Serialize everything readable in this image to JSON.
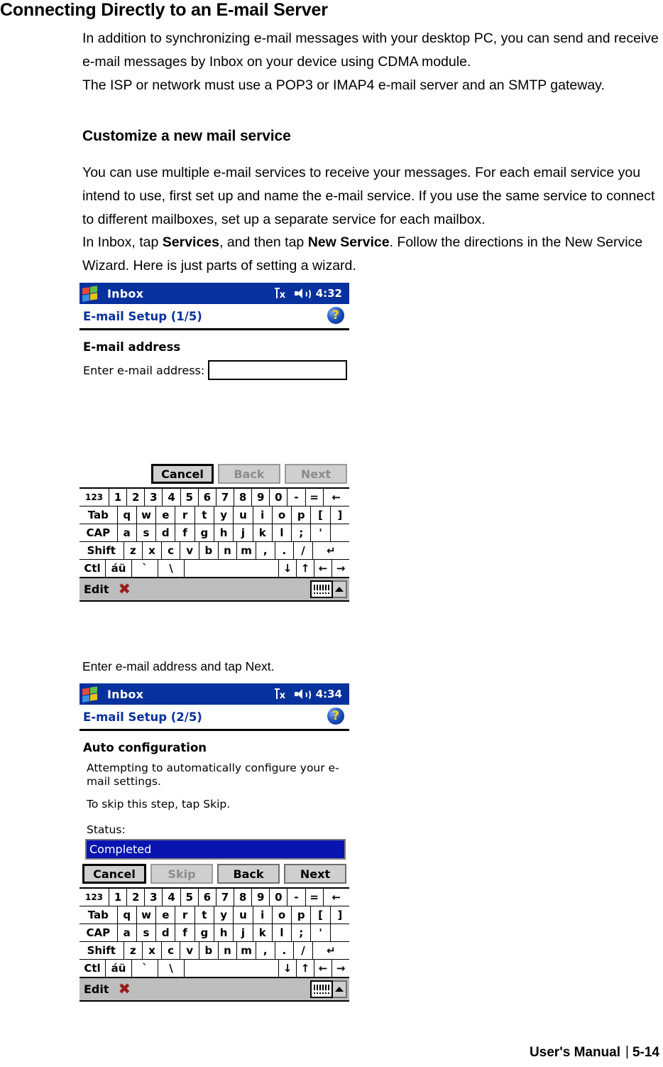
{
  "document": {
    "heading": "Connecting Directly to an E-mail Server",
    "intro_paragraph_1": "In addition to synchronizing e-mail messages with your desktop PC, you can send and receive e-mail messages by Inbox on your device using CDMA module.",
    "intro_paragraph_2": "The ISP or network must use a POP3 or IMAP4 e-mail server and an SMTP gateway.",
    "subheading": "Customize a new mail service",
    "body_paragraph_1": "You can use multiple e-mail services to receive your messages. For each email service you intend to use, first set up and name the e-mail service. If you use the same service to connect to different mailboxes, set up a separate service for each mailbox.",
    "body_paragraph_2_a": "In Inbox, tap ",
    "body_paragraph_2_b": "Services",
    "body_paragraph_2_c": ", and then tap ",
    "body_paragraph_2_d": "New Service",
    "body_paragraph_2_e": ". Follow the directions in the New Service Wizard. Here is just parts of setting a wizard.",
    "caption_1": "Enter e-mail address and tap Next.",
    "footer_label": "User's Manual",
    "footer_separator": "|",
    "footer_page": "5-14"
  },
  "colors": {
    "titlebar_blue": "#07319c",
    "link_blue": "#07319c",
    "status_highlight": "#0a14b0",
    "keyboard_gray": "#bdbdbd",
    "button_face": "#cfcfcf"
  },
  "screenshot1": {
    "app_title": "Inbox",
    "clock": "4:32",
    "signal_icon": "signal-no-service-icon",
    "volume_icon": "speaker-icon",
    "wizard_title": "E-mail Setup (1/5)",
    "help_icon": "help-question-icon",
    "section_heading": "E-mail address",
    "field_label": "Enter e-mail address:",
    "field_value": "",
    "buttons": [
      {
        "label": "Cancel",
        "state": "default"
      },
      {
        "label": "Back",
        "state": "disabled"
      },
      {
        "label": "Next",
        "state": "disabled"
      }
    ]
  },
  "screenshot2": {
    "app_title": "Inbox",
    "clock": "4:34",
    "signal_icon": "signal-no-service-icon",
    "volume_icon": "speaker-icon",
    "wizard_title": "E-mail Setup (2/5)",
    "help_icon": "help-question-icon",
    "section_heading": "Auto configuration",
    "paragraph_1": "Attempting to automatically configure your e-mail settings.",
    "paragraph_2": "To skip this step, tap Skip.",
    "status_label": "Status:",
    "status_value": "Completed",
    "buttons": [
      {
        "label": "Cancel",
        "state": "default"
      },
      {
        "label": "Skip",
        "state": "disabled"
      },
      {
        "label": "Back",
        "state": "enabled"
      },
      {
        "label": "Next",
        "state": "enabled"
      }
    ]
  },
  "keyboard": {
    "rows": [
      [
        "123",
        "1",
        "2",
        "3",
        "4",
        "5",
        "6",
        "7",
        "8",
        "9",
        "0",
        "-",
        "=",
        "←"
      ],
      [
        "Tab",
        "q",
        "w",
        "e",
        "r",
        "t",
        "y",
        "u",
        "i",
        "o",
        "p",
        "[",
        "]"
      ],
      [
        "CAP",
        "a",
        "s",
        "d",
        "f",
        "g",
        "h",
        "j",
        "k",
        "l",
        ";",
        "'",
        ""
      ],
      [
        "Shift",
        "z",
        "x",
        "c",
        "v",
        "b",
        "n",
        "m",
        ",",
        ".",
        "/",
        "↵"
      ],
      [
        "Ctl",
        "áü",
        "`",
        "\\",
        "",
        "↓",
        "↑",
        "←",
        "→"
      ]
    ],
    "toolbar_label": "Edit",
    "toolbar_close_icon": "red-x-icon",
    "toolbar_keyboard_icon": "keyboard-icon",
    "toolbar_arrow_icon": "chevron-up-icon"
  }
}
